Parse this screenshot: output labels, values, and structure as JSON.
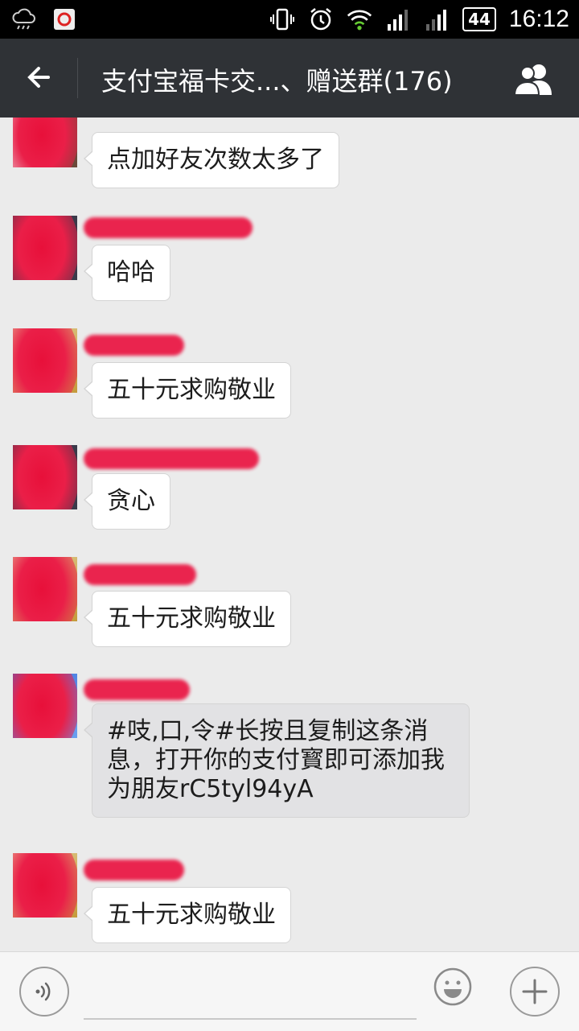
{
  "status_bar": {
    "time": "16:12",
    "battery": "44",
    "icons": [
      "cloud-rain-icon",
      "app-notification-icon",
      "vibrate-icon",
      "alarm-icon",
      "wifi-icon",
      "signal-icon",
      "signal-icon-2"
    ]
  },
  "header": {
    "title": "支付宝福卡交...、赠送群(176)",
    "back_icon": "arrow-left-icon",
    "members_icon": "group-members-icon"
  },
  "messages": [
    {
      "text": "点加好友次数太多了",
      "sender_name_redacted": true
    },
    {
      "text": "哈哈",
      "sender_name_redacted": true
    },
    {
      "text": "五十元求购敬业",
      "sender_name_redacted": true
    },
    {
      "text": "贪心",
      "sender_name_redacted": true
    },
    {
      "text": "五十元求购敬业",
      "sender_name_redacted": true
    },
    {
      "text": "#吱,口,令#长按且复制这条消息，打开你的支付寳即可添加我为朋友rC5tyl94yA",
      "sender_name_redacted": true
    },
    {
      "text": "五十元求购敬业",
      "sender_name_redacted": true
    }
  ],
  "input_bar": {
    "voice_icon": "voice-input-icon",
    "emoji_icon": "emoji-icon",
    "plus_icon": "plus-icon",
    "placeholder": ""
  },
  "colors": {
    "header_bg": "#2f3236",
    "chat_bg": "#ebebeb",
    "redaction": "#ea1a46"
  }
}
